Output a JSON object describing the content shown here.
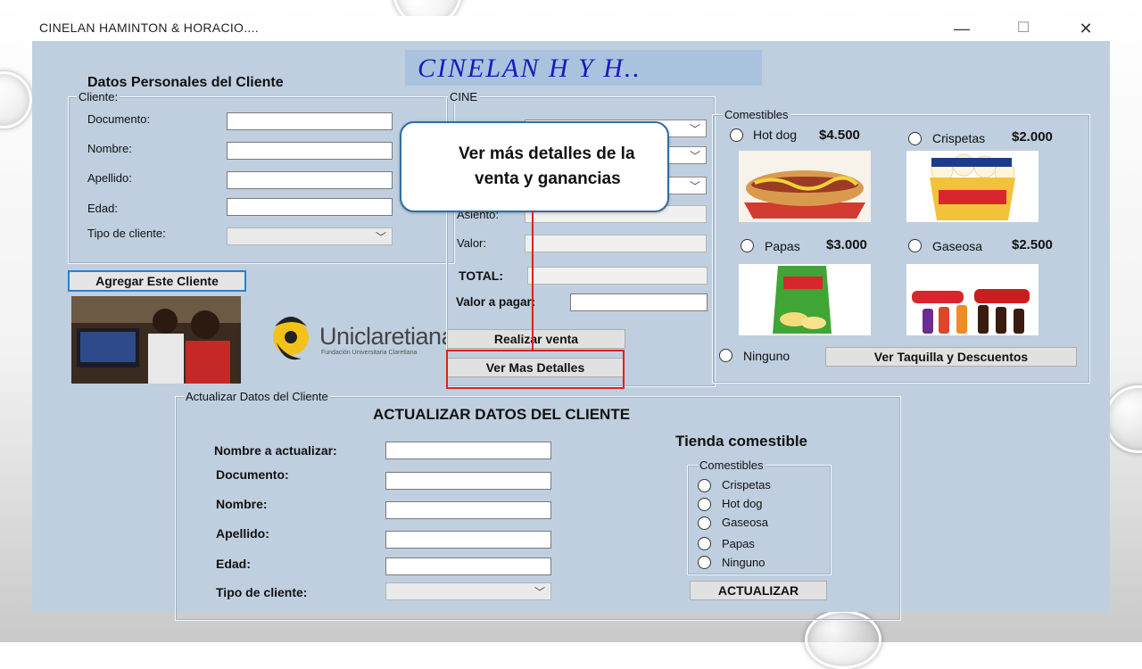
{
  "window": {
    "title": "CINELAN HAMINTON & HORACIO....",
    "controls": [
      "—",
      "☐",
      "✕"
    ]
  },
  "banner": {
    "text": "CINELAN H Y H.."
  },
  "client_section": {
    "heading": "Datos Personales del Cliente",
    "group_title": "Cliente:",
    "fields": {
      "documento": "Documento:",
      "nombre": "Nombre:",
      "apellido": "Apellido:",
      "edad": "Edad:",
      "tipo": "Tipo de cliente:"
    },
    "values": {
      "documento": "",
      "nombre": "",
      "apellido": "",
      "edad": "",
      "tipo": ""
    },
    "add_button": "Agregar Este Cliente"
  },
  "logo": {
    "name": "Uniclaretiana",
    "subtitle": "Fundación Universitaria Claretiana"
  },
  "cine": {
    "group_title": "CINE",
    "fields": {
      "asiento": "Asiento:",
      "valor": "Valor:",
      "total": "TOTAL:",
      "valor_pagar": "Valor a pagar:"
    },
    "buttons": {
      "realizar": "Realizar venta",
      "detalles": "Ver Mas Detalles"
    }
  },
  "callout": {
    "text_line1": "Ver más detalles de la",
    "text_line2": "venta y ganancias"
  },
  "comestibles": {
    "group_title": "Comestibles",
    "items": [
      {
        "name": "Hot dog",
        "price": "$4.500"
      },
      {
        "name": "Crispetas",
        "price": "$2.000"
      },
      {
        "name": "Papas",
        "price": "$3.000"
      },
      {
        "name": "Gaseosa",
        "price": "$2.500"
      }
    ],
    "ninguno": "Ninguno",
    "taquilla_button": "Ver Taquilla  y Descuentos"
  },
  "update_section": {
    "group_title": "Actualizar Datos del Cliente",
    "heading": "ACTUALIZAR DATOS DEL CLIENTE",
    "fields": {
      "nombre_actualizar": "Nombre a actualizar:",
      "documento": "Documento:",
      "nombre": "Nombre:",
      "apellido": "Apellido:",
      "edad": "Edad:",
      "tipo": "Tipo de cliente:"
    },
    "tienda_heading": "Tienda comestible",
    "tienda_group": "Comestibles",
    "tienda_options": [
      "Crispetas",
      "Hot dog",
      "Gaseosa",
      "Papas",
      "Ninguno"
    ],
    "actualizar_button": "ACTUALIZAR"
  },
  "colors": {
    "window_bg": "#bfcfdf",
    "banner_text": "#1a1ab8",
    "highlight": "#e02020",
    "callout_border": "#2e6da4"
  }
}
